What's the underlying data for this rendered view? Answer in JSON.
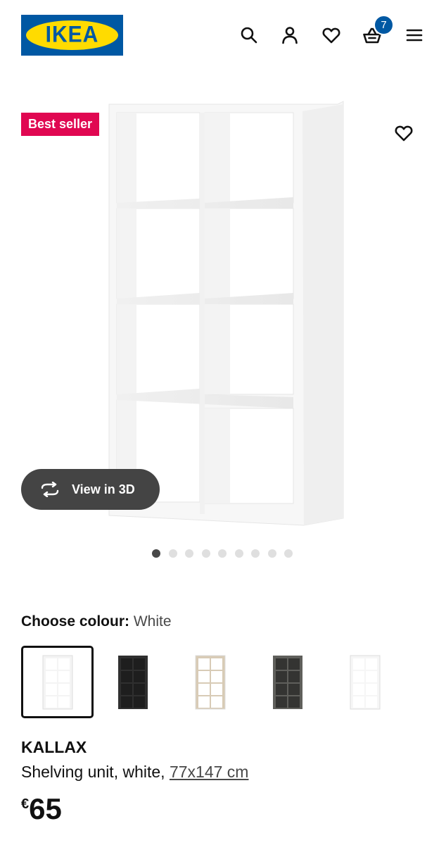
{
  "header": {
    "logo_text": "IKEA",
    "icons": [
      "search-icon",
      "user-icon",
      "heart-icon",
      "basket-icon",
      "menu-icon"
    ],
    "cart_count": "7"
  },
  "product_image": {
    "badge": "Best seller",
    "view_3d_label": "View in 3D",
    "dots_total": 9,
    "dots_active_index": 0
  },
  "colour": {
    "label": "Choose colour:",
    "value": "White",
    "swatches": [
      {
        "name": "white",
        "color": "#f4f4f4",
        "selected": true
      },
      {
        "name": "black-brown",
        "color": "#2f2f2f",
        "selected": false
      },
      {
        "name": "white-stained-oak",
        "color": "#d8cbb6",
        "selected": false
      },
      {
        "name": "grey-wood",
        "color": "#5f5f5b",
        "selected": false
      },
      {
        "name": "high-gloss-white",
        "color": "#f6f6f6",
        "selected": false
      }
    ]
  },
  "product": {
    "name": "KALLAX",
    "description": "Shelving unit, white, ",
    "dimensions": "77x147 cm",
    "currency": "€",
    "price": "65"
  },
  "colors": {
    "ikea_blue": "#0058a3",
    "ikea_yellow": "#ffdb00",
    "badge_red": "#e00751",
    "button_dark": "#444444"
  }
}
